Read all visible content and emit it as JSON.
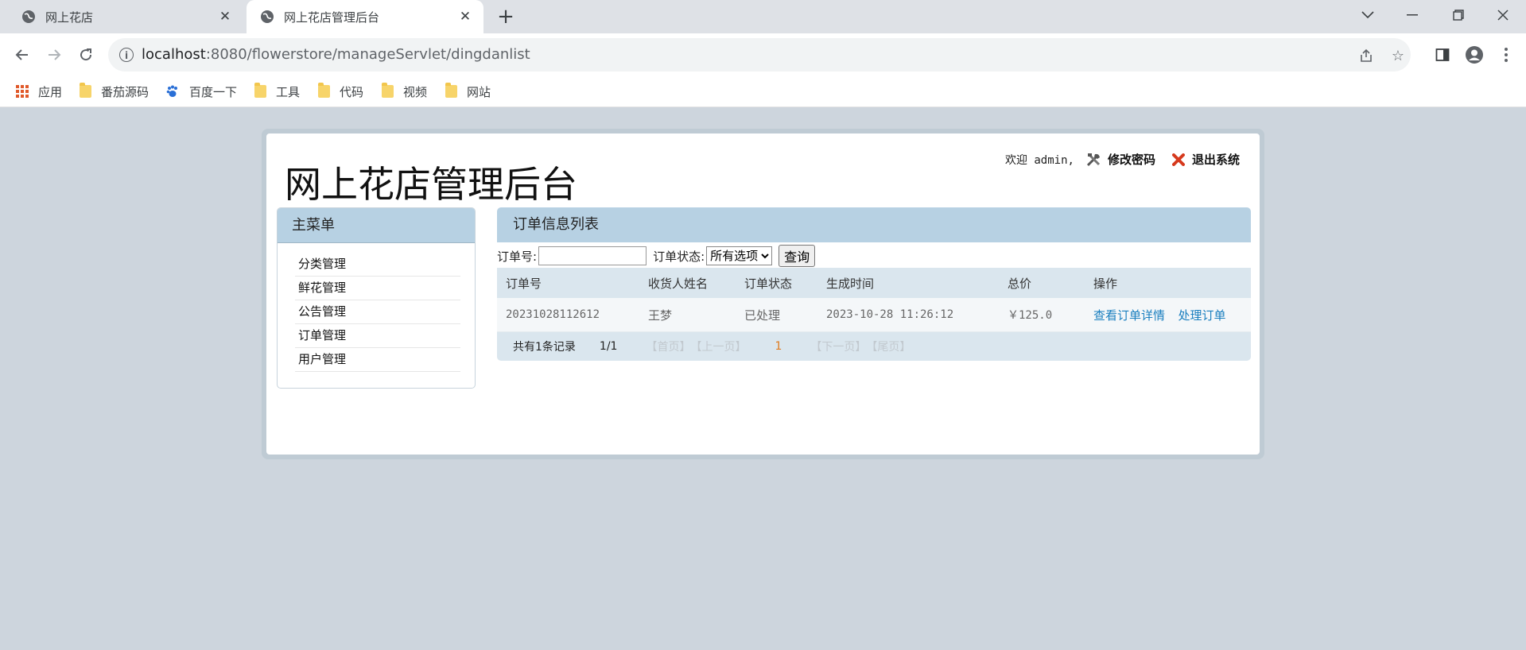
{
  "browser": {
    "tabs": [
      {
        "label": "网上花店",
        "active": false
      },
      {
        "label": "网上花店管理后台",
        "active": true
      }
    ],
    "url_host": "localhost",
    "url_path": ":8080/flowerstore/manageServlet/dingdanlist",
    "bookmarks": [
      "应用",
      "番茄源码",
      "百度一下",
      "工具",
      "代码",
      "视频",
      "网站"
    ]
  },
  "page": {
    "title": "网上花店管理后台",
    "welcome": "欢迎 admin,",
    "change_password": "修改密码",
    "logout": "退出系统"
  },
  "sidebar": {
    "title": "主菜单",
    "items": [
      {
        "label": "分类管理"
      },
      {
        "label": "鲜花管理"
      },
      {
        "label": "公告管理"
      },
      {
        "label": "订单管理"
      },
      {
        "label": "用户管理"
      }
    ]
  },
  "main": {
    "title": "订单信息列表",
    "search": {
      "order_no_label": "订单号:",
      "order_no_value": "",
      "status_label": "订单状态:",
      "status_selected": "所有选项",
      "query_button": "查询"
    },
    "table": {
      "headers": [
        "订单号",
        "收货人姓名",
        "订单状态",
        "生成时间",
        "总价",
        "操作"
      ],
      "rows": [
        {
          "order_no": "20231028112612",
          "receiver": "王梦",
          "status": "已处理",
          "created": "2023-10-28 11:26:12",
          "total": "￥125.0",
          "action_view": "查看订单详情",
          "action_process": "处理订单"
        }
      ]
    },
    "pager": {
      "total": "共有1条记录",
      "page_info": "1/1",
      "first": "【首页】",
      "prev": "【上一页】",
      "current": "1",
      "next": "【下一页】",
      "last": "【尾页】"
    }
  },
  "colors": {
    "header_blue": "#b7d1e3",
    "row_header": "#dae6ee",
    "link": "#1a7fbf",
    "page_background": "#cdd5dd"
  }
}
